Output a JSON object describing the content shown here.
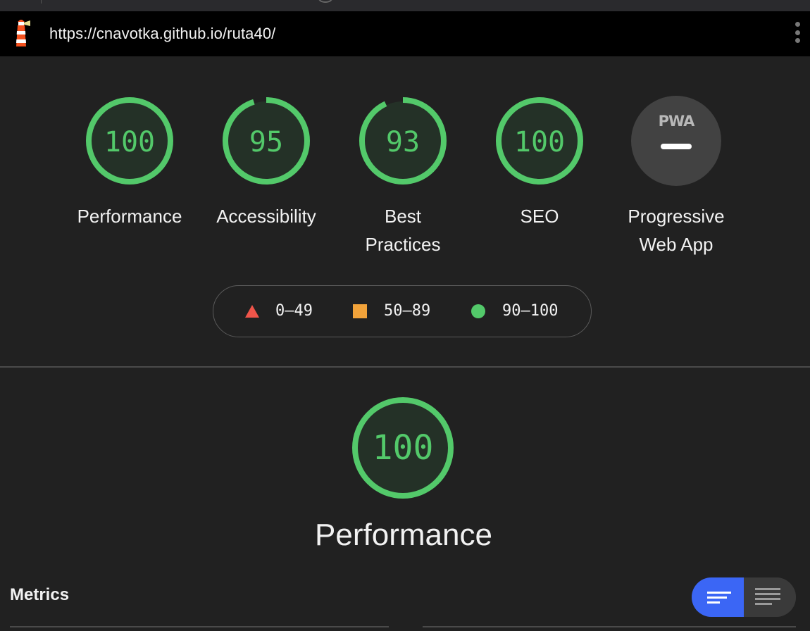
{
  "browser": {
    "url": "https://cnavotka.github.io/ruta40/"
  },
  "colors": {
    "pass": "#53c96a",
    "average": "#f2a33a",
    "fail": "#f0554a",
    "accent": "#3b66f5"
  },
  "gauges": [
    {
      "label": "Performance",
      "score": 100
    },
    {
      "label": "Accessibility",
      "score": 95
    },
    {
      "label": "Best Practices",
      "score": 93
    },
    {
      "label": "SEO",
      "score": 100
    },
    {
      "label": "Progressive Web App",
      "badge": "PWA",
      "score_text": "—"
    }
  ],
  "legend": [
    {
      "range": "0–49",
      "icon": "triangle-icon"
    },
    {
      "range": "50–89",
      "icon": "square-icon"
    },
    {
      "range": "90–100",
      "icon": "circle-icon"
    }
  ],
  "category": {
    "title": "Performance",
    "score": 100
  },
  "metrics": {
    "title": "Metrics",
    "view_toggle": [
      "summary-view-icon",
      "detail-view-icon"
    ]
  }
}
